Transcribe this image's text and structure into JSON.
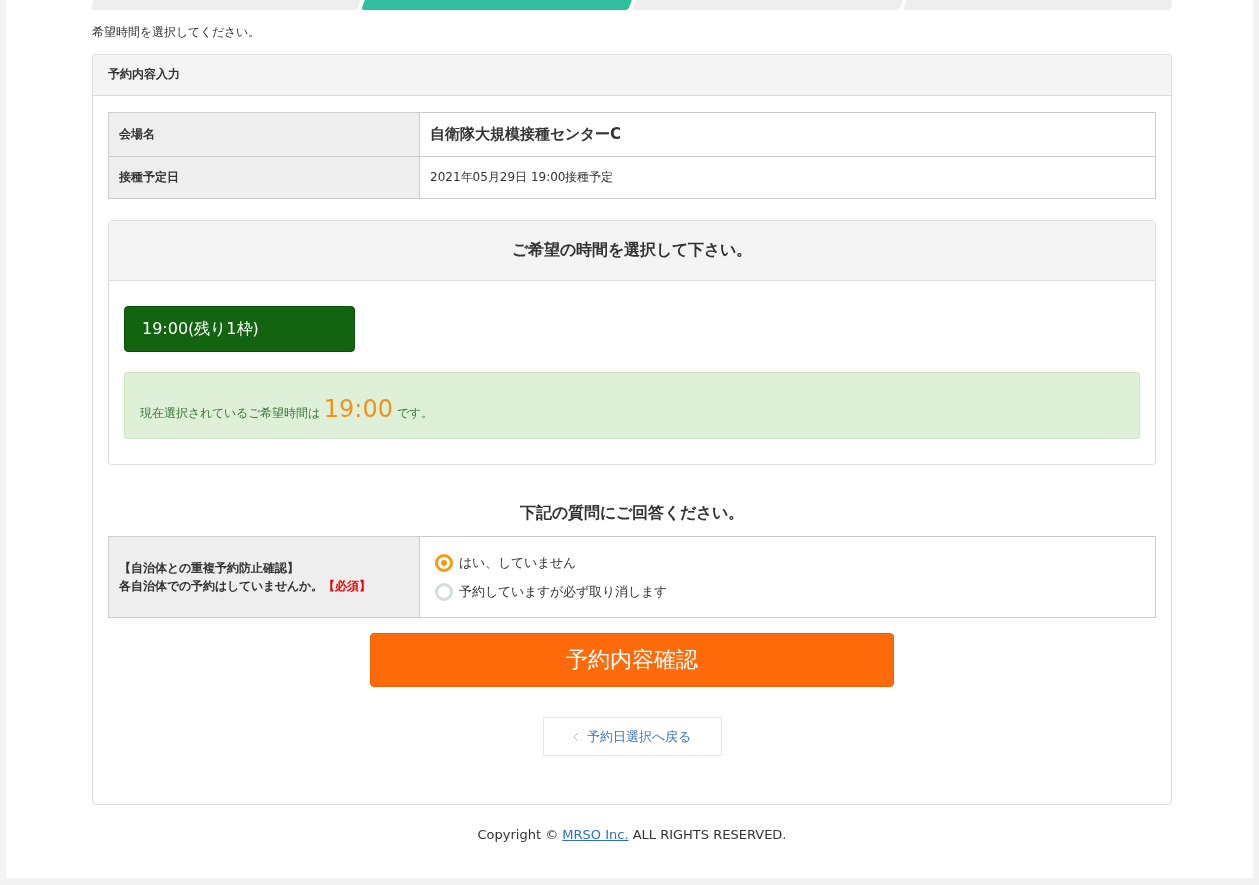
{
  "steps": [
    {
      "selected": false
    },
    {
      "selected": true
    },
    {
      "selected": false
    },
    {
      "selected": false
    }
  ],
  "instruction": "希望時間を選択してください。",
  "panel": {
    "title": "予約内容入力",
    "info": [
      {
        "label": "会場名",
        "value": "自衛隊大規模接種センターC",
        "kind": "emphasis"
      },
      {
        "label": "接種予定日",
        "value": "2021年05月29日 19:00接種予定",
        "kind": "plain"
      }
    ],
    "time_box": {
      "title": "ご希望の時間を選択して下さい。",
      "slots": [
        {
          "label": "19:00(残り1枠)",
          "selected": true
        }
      ],
      "notice": {
        "before": "現在選択されているご希望時間は",
        "time": "19:00",
        "after": "です。"
      }
    },
    "question_heading": "下記の質問にご回答ください。",
    "question": {
      "title": "【自治体との重複予約防止確認】",
      "text": "各自治体での予約はしていませんか。",
      "required": "【必須】",
      "options": [
        {
          "label": "はい、していません",
          "selected": true
        },
        {
          "label": "予約していますが必ず取り消します",
          "selected": false
        }
      ]
    },
    "confirm_button": "予約内容確認",
    "back_button": "予約日選択へ戻る"
  },
  "footer": {
    "before": "Copyright ©",
    "link": "MRSO Inc.",
    "after": "ALL RIGHTS RESERVED."
  }
}
